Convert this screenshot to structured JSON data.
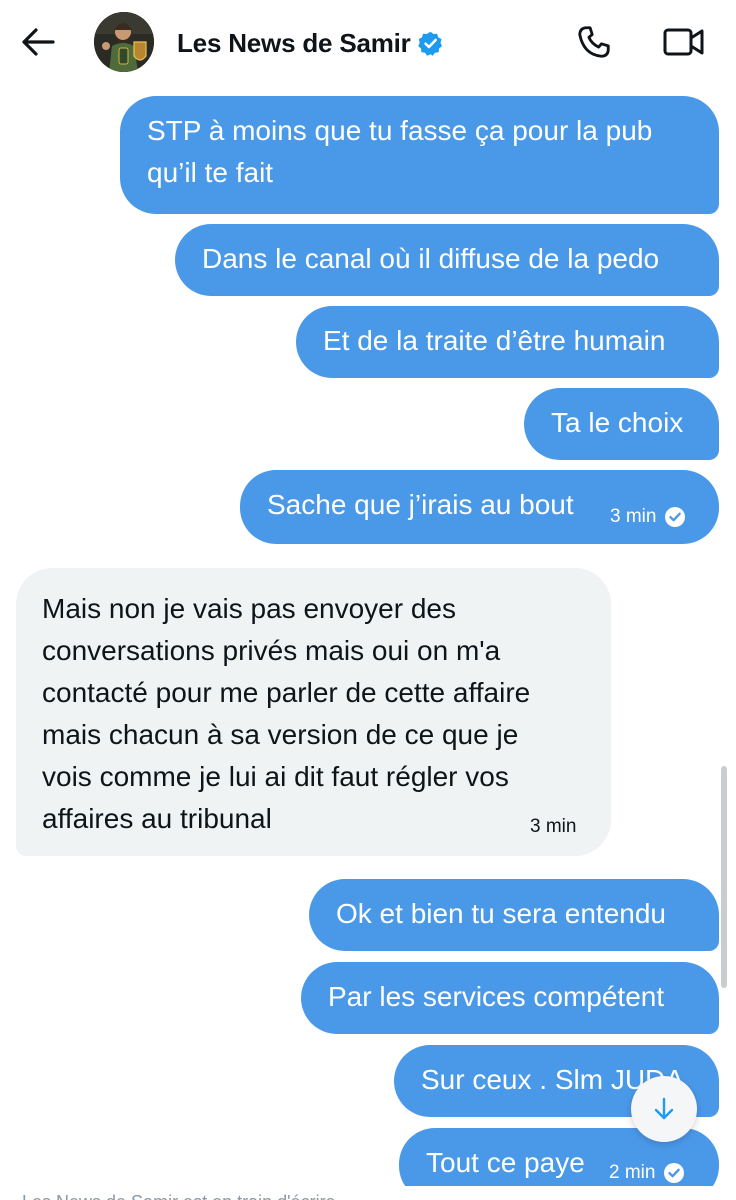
{
  "header": {
    "title": "Les News de Samir",
    "back_icon": "arrow-left-icon",
    "verified_icon": "verified-badge-icon",
    "call_icon": "phone-icon",
    "video_icon": "video-camera-icon",
    "accent_color": "#1d9bf0"
  },
  "messages": [
    {
      "direction": "sent",
      "lines": [
        "STP à moins que tu fasse ça pour la pub",
        "qu’il te fait"
      ]
    },
    {
      "direction": "sent",
      "lines": [
        "Dans le canal où il diffuse de la pedo"
      ]
    },
    {
      "direction": "sent",
      "lines": [
        "Et de la traite d’être humain"
      ]
    },
    {
      "direction": "sent",
      "lines": [
        "Ta le choix"
      ]
    },
    {
      "direction": "sent",
      "lines": [
        "Sache que j’irais au bout"
      ],
      "time": "3 min",
      "read": true
    },
    {
      "direction": "received",
      "lines": [
        "Mais non je vais pas envoyer des",
        "conversations privés mais oui on m'a",
        "contacté pour me parler de cette affaire",
        "mais chacun à sa version de ce que je",
        "vois comme je lui ai dit faut régler vos",
        "affaires au tribunal"
      ],
      "time": "3 min"
    },
    {
      "direction": "sent",
      "lines": [
        "Ok et bien tu sera entendu"
      ]
    },
    {
      "direction": "sent",
      "lines": [
        "Par les services compétent"
      ]
    },
    {
      "direction": "sent",
      "lines": [
        "Sur ceux . Slm JUDA"
      ]
    },
    {
      "direction": "sent",
      "lines": [
        "Tout ce paye"
      ],
      "time": "2 min",
      "read": true
    }
  ],
  "scroll_down_icon": "arrow-down-icon",
  "footer": {
    "text": "Les News de Samir est en train d'écrire"
  },
  "colors": {
    "sent_bubble": "#4a99e9",
    "received_bubble": "#eff3f4"
  }
}
